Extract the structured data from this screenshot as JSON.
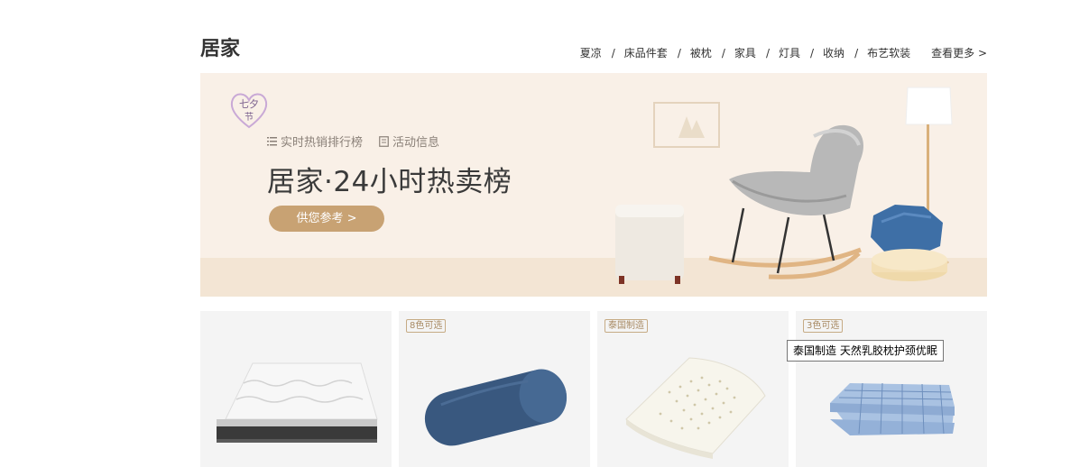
{
  "header": {
    "title": "居家",
    "nav": [
      "夏凉",
      "床品件套",
      "被枕",
      "家具",
      "灯具",
      "收纳",
      "布艺软装"
    ],
    "separator": "/",
    "more": "查看更多 >"
  },
  "banner": {
    "tabs": [
      {
        "icon": "list-icon",
        "label": "实时热销排行榜"
      },
      {
        "icon": "note-icon",
        "label": "活动信息"
      }
    ],
    "title": "居家·24小时热卖榜",
    "button": "供您参考 >",
    "logo_text": "七夕节",
    "colors": {
      "bg": "#f9f0e7",
      "accent": "#c8a273"
    }
  },
  "products": [
    {
      "tag": "",
      "image": "mattress"
    },
    {
      "tag": "8色可选",
      "image": "blue-bolster-pillow"
    },
    {
      "tag": "泰国制造",
      "image": "latex-pillow"
    },
    {
      "tag": "3色可选",
      "image": "plaid-quilt"
    }
  ],
  "tooltip": "泰国制造 天然乳胶枕护颈优眠"
}
